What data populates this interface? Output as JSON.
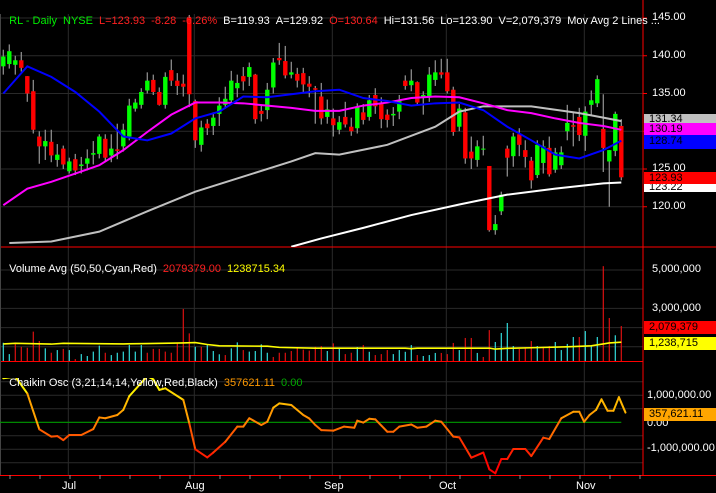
{
  "header": {
    "symbol": "RL - Daily",
    "exchange": "NYSE",
    "last": "L=123.93",
    "change": "-8.28",
    "change_pct": "-6.26%",
    "bid": "B=119.93",
    "ask": "A=129.92",
    "open": "O=130.64",
    "high": "Hi=131.56",
    "low": "Lo=123.90",
    "volume": "V=2,079,379",
    "study": "Mov Avg 2 Lines ..."
  },
  "price_axis": {
    "ticks": [
      "145.00",
      "140.00",
      "135.00",
      "125.00",
      "120.00"
    ],
    "tags": {
      "ma_gray": "131.34",
      "ma_magenta": "130.19",
      "ma_blue": "128.74",
      "last": "123.93",
      "ma_white": "123.22"
    }
  },
  "volume_panel": {
    "title": "Volume Avg (50,50,Cyan,Red)",
    "value": "2079379.00",
    "avg": "1238715.34",
    "ticks": [
      "5,000,000",
      "3,000,000"
    ],
    "tags": {
      "volume": "2,079,379",
      "avg": "1,238,715"
    }
  },
  "chaikin_panel": {
    "title": "Chaikin Osc (3,21,14,14,Yellow,Red,Black)",
    "value": "357621.11",
    "zero": "0.00",
    "ticks": [
      "1,000,000.00",
      "0.00",
      "-1,000,000.00"
    ],
    "tag": "357,621.11"
  },
  "x_axis": {
    "months": [
      "Jul",
      "Aug",
      "Sep",
      "Oct",
      "Nov"
    ]
  },
  "colors": {
    "up": "#00ff00",
    "down": "#ff0000",
    "wick": "#8c8c8c",
    "ma_blue": "#0000ff",
    "ma_magenta": "#ff00ff",
    "ma_gray": "#c0c0c0",
    "ma_white": "#ffffff",
    "vol_up": "#33dddd",
    "vol_down": "#dd1111",
    "vol_avg": "#ffff00",
    "axis": "#ff0000",
    "grid": "#2a2a2a",
    "zero_line": "#009900"
  },
  "chart_data": {
    "type": "candlestick",
    "title": "RL - Daily NYSE",
    "price_range": [
      114.5,
      147.5
    ],
    "ohlc": [
      [
        138.6,
        140.8,
        137.5,
        139.9
      ],
      [
        138.9,
        141.5,
        138.3,
        140.6
      ],
      [
        138.8,
        140.0,
        137.5,
        139.4
      ],
      [
        139.4,
        140.5,
        137.9,
        138.4
      ],
      [
        137.3,
        137.3,
        133.9,
        135.0
      ],
      [
        135.3,
        136.8,
        129.7,
        130.2
      ],
      [
        129.3,
        130.0,
        125.7,
        128.0
      ],
      [
        128.0,
        130.2,
        126.2,
        128.7
      ],
      [
        128.6,
        130.2,
        125.9,
        126.8
      ],
      [
        126.2,
        128.3,
        125.3,
        126.9
      ],
      [
        127.7,
        128.1,
        125.0,
        125.6
      ],
      [
        124.7,
        126.5,
        124.4,
        126.0
      ],
      [
        126.3,
        127.0,
        124.2,
        124.8
      ],
      [
        125.4,
        126.6,
        124.4,
        125.6
      ],
      [
        125.7,
        127.6,
        124.8,
        126.4
      ],
      [
        126.9,
        128.7,
        125.6,
        127.1
      ],
      [
        127.0,
        129.6,
        126.4,
        129.3
      ],
      [
        129.0,
        129.6,
        126.0,
        126.5
      ],
      [
        126.8,
        129.6,
        125.9,
        127.7
      ],
      [
        127.6,
        131.0,
        126.3,
        127.4
      ],
      [
        128.0,
        131.0,
        127.3,
        130.2
      ],
      [
        129.3,
        134.3,
        128.8,
        133.4
      ],
      [
        133.0,
        134.3,
        132.6,
        133.8
      ],
      [
        133.5,
        135.7,
        133.0,
        135.2
      ],
      [
        135.4,
        137.8,
        135.0,
        136.7
      ],
      [
        136.8,
        137.5,
        134.8,
        135.2
      ],
      [
        135.2,
        135.8,
        133.4,
        133.5
      ],
      [
        133.5,
        137.8,
        133.0,
        137.2
      ],
      [
        138.1,
        139.5,
        136.0,
        136.7
      ],
      [
        136.7,
        137.7,
        134.8,
        136.0
      ],
      [
        136.3,
        137.5,
        134.6,
        135.9
      ],
      [
        145.0,
        145.4,
        133.2,
        134.9
      ],
      [
        134.0,
        134.2,
        127.8,
        128.8
      ],
      [
        128.2,
        131.4,
        127.3,
        130.5
      ],
      [
        131.0,
        131.6,
        129.5,
        130.4
      ],
      [
        130.7,
        132.5,
        129.5,
        131.8
      ],
      [
        132.3,
        134.5,
        130.7,
        133.4
      ],
      [
        133.5,
        135.9,
        133.0,
        134.3
      ],
      [
        134.1,
        138.0,
        133.5,
        136.7
      ],
      [
        135.7,
        137.5,
        134.5,
        136.4
      ],
      [
        137.3,
        138.5,
        135.4,
        136.6
      ],
      [
        137.2,
        139.1,
        136.0,
        138.5
      ],
      [
        137.5,
        137.6,
        131.0,
        131.6
      ],
      [
        132.7,
        133.4,
        131.3,
        132.3
      ],
      [
        132.8,
        136.4,
        131.6,
        135.5
      ],
      [
        135.8,
        139.7,
        135.0,
        139.1
      ],
      [
        139.7,
        141.7,
        138.8,
        139.4
      ],
      [
        139.3,
        141.3,
        137.0,
        137.4
      ],
      [
        137.5,
        139.2,
        137.0,
        137.8
      ],
      [
        137.6,
        138.4,
        135.8,
        136.7
      ],
      [
        137.7,
        138.4,
        135.2,
        136.2
      ],
      [
        136.3,
        137.3,
        134.5,
        135.9
      ],
      [
        135.7,
        136.0,
        131.0,
        135.5
      ],
      [
        134.6,
        136.4,
        130.9,
        131.7
      ],
      [
        131.9,
        134.2,
        131.0,
        132.9
      ],
      [
        131.7,
        133.0,
        129.3,
        130.8
      ],
      [
        130.2,
        132.0,
        129.6,
        131.2
      ],
      [
        131.9,
        133.9,
        130.5,
        130.9
      ],
      [
        130.6,
        131.8,
        129.4,
        130.0
      ],
      [
        130.4,
        133.7,
        129.7,
        133.2
      ],
      [
        132.5,
        133.6,
        130.9,
        131.5
      ],
      [
        131.9,
        134.8,
        131.4,
        134.1
      ],
      [
        134.8,
        135.7,
        132.3,
        133.3
      ],
      [
        133.7,
        134.5,
        130.4,
        131.6
      ],
      [
        132.2,
        132.9,
        130.5,
        131.5
      ],
      [
        132.1,
        133.2,
        130.7,
        132.3
      ],
      [
        132.6,
        134.8,
        131.6,
        134.1
      ],
      [
        136.7,
        137.4,
        135.5,
        136.0
      ],
      [
        136.1,
        138.2,
        135.3,
        136.7
      ],
      [
        136.5,
        136.6,
        133.5,
        133.8
      ],
      [
        134.5,
        135.3,
        132.2,
        134.8
      ],
      [
        134.6,
        138.5,
        133.9,
        137.5
      ],
      [
        136.8,
        139.4,
        136.0,
        137.8
      ],
      [
        137.8,
        139.6,
        137.0,
        137.5
      ],
      [
        137.8,
        139.6,
        135.0,
        135.3
      ],
      [
        135.5,
        135.9,
        129.4,
        129.9
      ],
      [
        130.6,
        133.6,
        130.0,
        133.0
      ],
      [
        132.5,
        133.1,
        125.7,
        126.4
      ],
      [
        127.3,
        129.3,
        125.0,
        126.4
      ],
      [
        126.2,
        128.8,
        125.3,
        128.0
      ],
      [
        127.7,
        129.4,
        126.8,
        127.7
      ],
      [
        125.4,
        125.4,
        116.7,
        116.9
      ],
      [
        116.9,
        118.9,
        116.3,
        117.7
      ],
      [
        119.4,
        122.0,
        118.9,
        121.6
      ],
      [
        127.7,
        128.1,
        124.0,
        126.5
      ],
      [
        126.7,
        129.8,
        125.3,
        129.3
      ],
      [
        129.6,
        130.4,
        126.7,
        128.2
      ],
      [
        127.5,
        128.8,
        125.2,
        126.6
      ],
      [
        126.1,
        126.6,
        122.4,
        123.5
      ],
      [
        124.2,
        128.8,
        123.8,
        128.2
      ],
      [
        125.8,
        128.8,
        124.4,
        128.0
      ],
      [
        127.8,
        129.3,
        124.0,
        124.3
      ],
      [
        124.9,
        127.8,
        124.5,
        127.2
      ],
      [
        125.5,
        128.0,
        125.0,
        127.2
      ],
      [
        130.0,
        133.5,
        128.8,
        131.1
      ],
      [
        130.8,
        132.6,
        128.0,
        130.6
      ],
      [
        131.9,
        133.1,
        128.7,
        129.5
      ],
      [
        129.4,
        133.3,
        127.4,
        132.6
      ],
      [
        133.5,
        135.4,
        132.2,
        134.1
      ],
      [
        133.7,
        137.4,
        133.2,
        136.9
      ],
      [
        130.3,
        134.9,
        124.6,
        127.8
      ],
      [
        126.0,
        127.5,
        120.0,
        127.5
      ],
      [
        127.4,
        132.6,
        126.7,
        132.3
      ],
      [
        130.7,
        131.6,
        123.5,
        123.9
      ]
    ],
    "moving_averages": {
      "blue": [
        [
          0,
          135.0
        ],
        [
          4,
          138.6
        ],
        [
          8,
          137.2
        ],
        [
          12,
          135.2
        ],
        [
          16,
          132.6
        ],
        [
          20,
          129.3
        ],
        [
          24,
          128.8
        ],
        [
          28,
          129.7
        ],
        [
          32,
          131.7
        ],
        [
          36,
          132.6
        ],
        [
          40,
          134.6
        ],
        [
          44,
          134.5
        ],
        [
          48,
          134.9
        ],
        [
          52,
          135.3
        ],
        [
          56,
          135.5
        ],
        [
          60,
          134.4
        ],
        [
          64,
          134.0
        ],
        [
          68,
          133.4
        ],
        [
          72,
          133.7
        ],
        [
          76,
          133.8
        ],
        [
          80,
          132.8
        ],
        [
          84,
          130.6
        ],
        [
          88,
          128.8
        ],
        [
          92,
          126.9
        ],
        [
          96,
          126.4
        ],
        [
          100,
          127.5
        ],
        [
          103,
          128.74
        ]
      ],
      "magenta": [
        [
          0,
          120.2
        ],
        [
          4,
          122.4
        ],
        [
          8,
          123.3
        ],
        [
          12,
          124.4
        ],
        [
          16,
          125.5
        ],
        [
          20,
          127.5
        ],
        [
          24,
          129.9
        ],
        [
          28,
          132.2
        ],
        [
          32,
          133.8
        ],
        [
          36,
          133.8
        ],
        [
          40,
          133.7
        ],
        [
          44,
          133.4
        ],
        [
          48,
          133.1
        ],
        [
          52,
          132.7
        ],
        [
          56,
          132.7
        ],
        [
          60,
          133.4
        ],
        [
          64,
          133.8
        ],
        [
          68,
          134.4
        ],
        [
          72,
          134.6
        ],
        [
          76,
          134.5
        ],
        [
          80,
          133.7
        ],
        [
          84,
          132.8
        ],
        [
          88,
          132.4
        ],
        [
          92,
          131.7
        ],
        [
          96,
          131.1
        ],
        [
          100,
          130.7
        ],
        [
          103,
          130.19
        ]
      ],
      "gray": [
        [
          1,
          115.2
        ],
        [
          8,
          115.4
        ],
        [
          16,
          116.7
        ],
        [
          24,
          119.4
        ],
        [
          32,
          122.0
        ],
        [
          40,
          124.0
        ],
        [
          48,
          126.0
        ],
        [
          52,
          127.1
        ],
        [
          56,
          126.9
        ],
        [
          64,
          128.2
        ],
        [
          72,
          130.6
        ],
        [
          76,
          132.6
        ],
        [
          80,
          133.3
        ],
        [
          88,
          133.3
        ],
        [
          96,
          132.4
        ],
        [
          100,
          131.8
        ],
        [
          103,
          131.34
        ]
      ],
      "white": [
        [
          48,
          114.7
        ],
        [
          53,
          115.8
        ],
        [
          60,
          117.2
        ],
        [
          68,
          118.9
        ],
        [
          76,
          120.3
        ],
        [
          84,
          121.6
        ],
        [
          92,
          122.4
        ],
        [
          100,
          123.1
        ],
        [
          103,
          123.22
        ]
      ]
    },
    "volume_millions": [
      1.21,
      0.62,
      1.14,
      1.0,
      0.95,
      1.79,
      1.3,
      0.92,
      0.69,
      0.83,
      0.89,
      0.83,
      0.36,
      0.62,
      0.52,
      0.75,
      1.06,
      0.69,
      0.57,
      0.69,
      0.75,
      1.09,
      0.75,
      1.09,
      0.69,
      0.89,
      0.89,
      0.75,
      0.69,
      1.21,
      2.97,
      1.7,
      1.0,
      1.0,
      1.09,
      0.78,
      0.61,
      0.57,
      0.92,
      1.23,
      0.83,
      0.75,
      0.78,
      1.13,
      0.69,
      0.47,
      0.69,
      0.69,
      0.78,
      0.97,
      0.85,
      0.8,
      1.0,
      1.04,
      0.78,
      1.18,
      0.92,
      0.62,
      0.69,
      0.99,
      1.09,
      0.74,
      0.57,
      0.62,
      0.83,
      0.62,
      0.83,
      0.74,
      1.09,
      0.57,
      0.52,
      0.57,
      0.68,
      0.68,
      0.62,
      1.2,
      0.83,
      1.46,
      1.46,
      0.68,
      0.47,
      1.87,
      1.25,
      1.72,
      2.24,
      1.04,
      0.89,
      0.94,
      1.3,
      1.04,
      0.94,
      1.04,
      1.25,
      0.83,
      1.15,
      1.51,
      1.51,
      1.82,
      1.04,
      1.51,
      5.2,
      2.5,
      1.6,
      2.08
    ],
    "volume_dir": "ccrrrrrcrcrcrccccrccccccrrrrrrrrcrcccrccrccccrrrrrrrrrcrcrrcrcrrrccccrcccrrrcrrcrrccccrrrcrrccccrcccrrcr",
    "volume_avg_millions": [
      [
        0,
        1.15
      ],
      [
        2,
        1.18
      ],
      [
        8,
        1.14
      ],
      [
        10,
        1.18
      ],
      [
        14,
        1.17
      ],
      [
        20,
        1.15
      ],
      [
        24,
        1.17
      ],
      [
        30,
        1.2
      ],
      [
        32,
        1.22
      ],
      [
        34,
        1.12
      ],
      [
        36,
        1.05
      ],
      [
        44,
        1.03
      ],
      [
        46,
        0.97
      ],
      [
        52,
        0.93
      ],
      [
        67,
        0.93
      ],
      [
        68,
        0.9
      ],
      [
        69,
        0.93
      ],
      [
        81,
        0.93
      ],
      [
        82,
        0.88
      ],
      [
        84,
        0.92
      ],
      [
        88,
        0.95
      ],
      [
        94,
        1.0
      ],
      [
        98,
        1.05
      ],
      [
        100,
        1.15
      ],
      [
        101,
        1.2
      ],
      [
        103,
        1.24
      ]
    ],
    "volume_range_millions": [
      0,
      5.6
    ],
    "chaikin_millions": [
      [
        0,
        1.63
      ],
      [
        2,
        1.69
      ],
      [
        4,
        1.07
      ],
      [
        6,
        -0.26
      ],
      [
        8,
        -0.53
      ],
      [
        9,
        -0.51
      ],
      [
        10,
        -0.66
      ],
      [
        11,
        -0.47
      ],
      [
        13,
        -0.47
      ],
      [
        15,
        -0.25
      ],
      [
        16,
        0.18
      ],
      [
        17,
        0.15
      ],
      [
        19,
        0.27
      ],
      [
        20,
        0.46
      ],
      [
        21,
        0.97
      ],
      [
        24,
        1.71
      ],
      [
        25,
        1.59
      ],
      [
        26,
        1.2
      ],
      [
        27,
        1.26
      ],
      [
        30,
        0.83
      ],
      [
        31,
        -0.04
      ],
      [
        32,
        -1.0
      ],
      [
        34,
        -1.3
      ],
      [
        35,
        -1.12
      ],
      [
        37,
        -0.72
      ],
      [
        39,
        -0.16
      ],
      [
        40,
        -0.16
      ],
      [
        41,
        0.15
      ],
      [
        43,
        -0.1
      ],
      [
        44,
        0.02
      ],
      [
        45,
        0.54
      ],
      [
        46,
        0.7
      ],
      [
        48,
        0.64
      ],
      [
        50,
        0.27
      ],
      [
        51,
        0.14
      ],
      [
        52,
        -0.1
      ],
      [
        53,
        -0.29
      ],
      [
        55,
        -0.31
      ],
      [
        56.8,
        -0.16
      ],
      [
        58.5,
        -0.2
      ],
      [
        59,
        0.06
      ],
      [
        60,
        -0.01
      ],
      [
        61,
        0.13
      ],
      [
        62,
        0.11
      ],
      [
        64,
        -0.35
      ],
      [
        65,
        -0.35
      ],
      [
        66,
        -0.16
      ],
      [
        68,
        -0.08
      ],
      [
        69,
        -0.2
      ],
      [
        70.5,
        -0.16
      ],
      [
        72,
        0.06
      ],
      [
        73,
        0.02
      ],
      [
        75,
        -0.53
      ],
      [
        76,
        -0.56
      ],
      [
        78,
        -1.31
      ],
      [
        80,
        -1.12
      ],
      [
        81,
        -1.74
      ],
      [
        82,
        -1.89
      ],
      [
        83,
        -1.36
      ],
      [
        84,
        -1.36
      ],
      [
        85,
        -0.99
      ],
      [
        87,
        -0.99
      ],
      [
        88,
        -1.25
      ],
      [
        90,
        -0.57
      ],
      [
        91,
        -0.62
      ],
      [
        93,
        0.15
      ],
      [
        95,
        0.39
      ],
      [
        96,
        0.39
      ],
      [
        96.8,
        0.02
      ],
      [
        97.7,
        0.27
      ],
      [
        98.8,
        0.46
      ],
      [
        99.7,
        0.85
      ],
      [
        100.7,
        0.43
      ],
      [
        101.7,
        0.43
      ],
      [
        102.6,
        0.93
      ],
      [
        103.7,
        0.36
      ]
    ],
    "chaikin_range_millions": [
      -2.0,
      1.9
    ],
    "month_start_bars": [
      11,
      32,
      55,
      74,
      97
    ]
  }
}
